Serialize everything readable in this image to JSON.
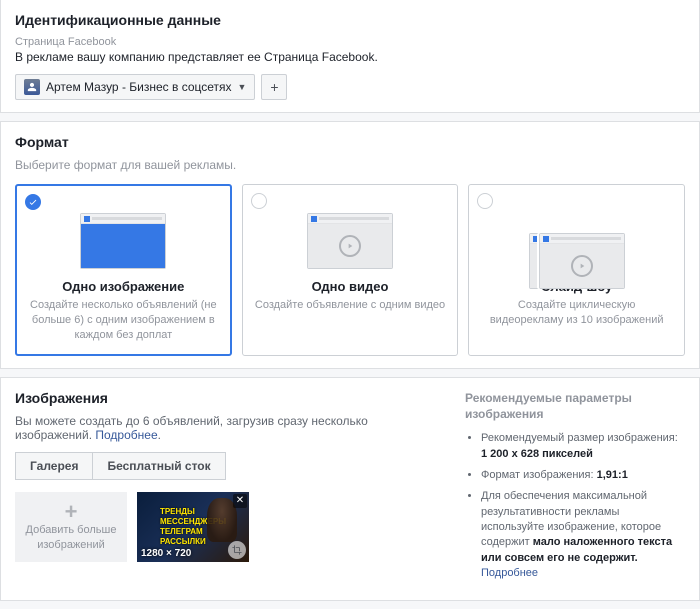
{
  "identity": {
    "title": "Идентификационные данные",
    "page_label": "Страница Facebook",
    "page_desc": "В рекламе вашу компанию представляет ее Страница Facebook.",
    "selected_page": "Артем Мазур - Бизнес в соцсетях"
  },
  "format": {
    "title": "Формат",
    "desc": "Выберите формат для вашей рекламы.",
    "cards": [
      {
        "title": "Одно изображение",
        "sub": "Создайте несколько объявлений (не больше 6) с одним изображением в каждом без доплат"
      },
      {
        "title": "Одно видео",
        "sub": "Создайте объявление с одним видео"
      },
      {
        "title": "Слайд-шоу",
        "sub": "Создайте циклическую видеорекламу из 10 изображений"
      }
    ]
  },
  "images": {
    "title": "Изображения",
    "desc": "Вы можете создать до 6 объявлений, загрузив сразу несколько изображений.",
    "learn_more": "Подробнее",
    "tabs": {
      "gallery": "Галерея",
      "stock": "Бесплатный сток"
    },
    "add_more": "Добавить больше изображений",
    "thumb": {
      "l1": "ТРЕНДЫ",
      "l2": "МЕССЕНДЖЕРЫ",
      "l3": "ТЕЛЕГРАМ",
      "l4": "РАССЫЛКИ",
      "dims": "1280 × 720"
    },
    "recs": {
      "heading": "Рекомендуемые параметры изображения",
      "size_label": "Рекомендуемый размер изображения:",
      "size_value": "1 200 x 628 пикселей",
      "ratio_label": "Формат изображения:",
      "ratio_value": "1,91:1",
      "text_note_pre": "Для обеспечения максимальной результативности рекламы используйте изображение, которое содержит",
      "text_note_bold": "мало наложенного текста или совсем его не содержит.",
      "learn_more": "Подробнее"
    }
  }
}
